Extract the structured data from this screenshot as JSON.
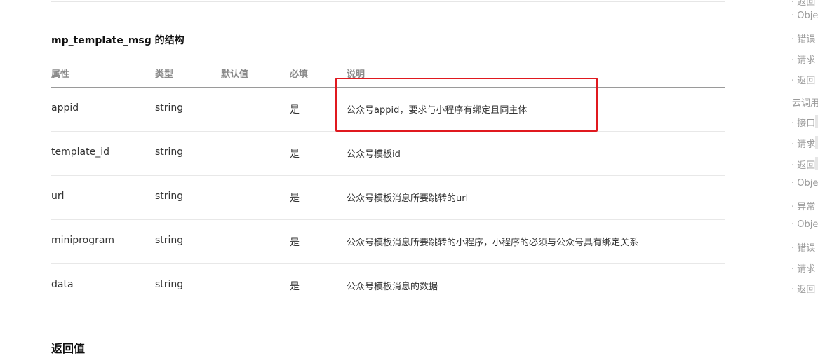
{
  "section": {
    "title": "mp_template_msg 的结构"
  },
  "table": {
    "headers": [
      "属性",
      "类型",
      "默认值",
      "必填",
      "说明"
    ],
    "rows": [
      {
        "name": "appid",
        "type": "string",
        "default": "",
        "required": "是",
        "desc": "公众号appid，要求与小程序有绑定且同主体"
      },
      {
        "name": "template_id",
        "type": "string",
        "default": "",
        "required": "是",
        "desc": "公众号模板id"
      },
      {
        "name": "url",
        "type": "string",
        "default": "",
        "required": "是",
        "desc": "公众号模板消息所要跳转的url"
      },
      {
        "name": "miniprogram",
        "type": "string",
        "default": "",
        "required": "是",
        "desc": "公众号模板消息所要跳转的小程序，小程序的必须与公众号具有绑定关系"
      },
      {
        "name": "data",
        "type": "string",
        "default": "",
        "required": "是",
        "desc": "公众号模板消息的数据"
      }
    ]
  },
  "next_section": {
    "title": "返回值"
  },
  "sidebar": {
    "items": [
      {
        "label": "返回",
        "kind": "sub"
      },
      {
        "label": "Obje",
        "kind": "sub"
      },
      {
        "label": "错误",
        "kind": "sub"
      },
      {
        "label": "请求",
        "kind": "sub"
      },
      {
        "label": "返回",
        "kind": "sub"
      },
      {
        "label": "云调用",
        "kind": "group"
      },
      {
        "label": "接口",
        "kind": "sub"
      },
      {
        "label": "请求",
        "kind": "sub"
      },
      {
        "label": "返回",
        "kind": "sub"
      },
      {
        "label": "Obje",
        "kind": "sub"
      },
      {
        "label": "异常",
        "kind": "sub"
      },
      {
        "label": "Obje",
        "kind": "sub"
      },
      {
        "label": "错误",
        "kind": "sub"
      },
      {
        "label": "请求",
        "kind": "sub"
      },
      {
        "label": "返回",
        "kind": "sub"
      }
    ]
  },
  "colors": {
    "highlight_border": "#e0191f",
    "header_text": "#8a8a8a",
    "sidebar_text": "#9a9a9a"
  }
}
